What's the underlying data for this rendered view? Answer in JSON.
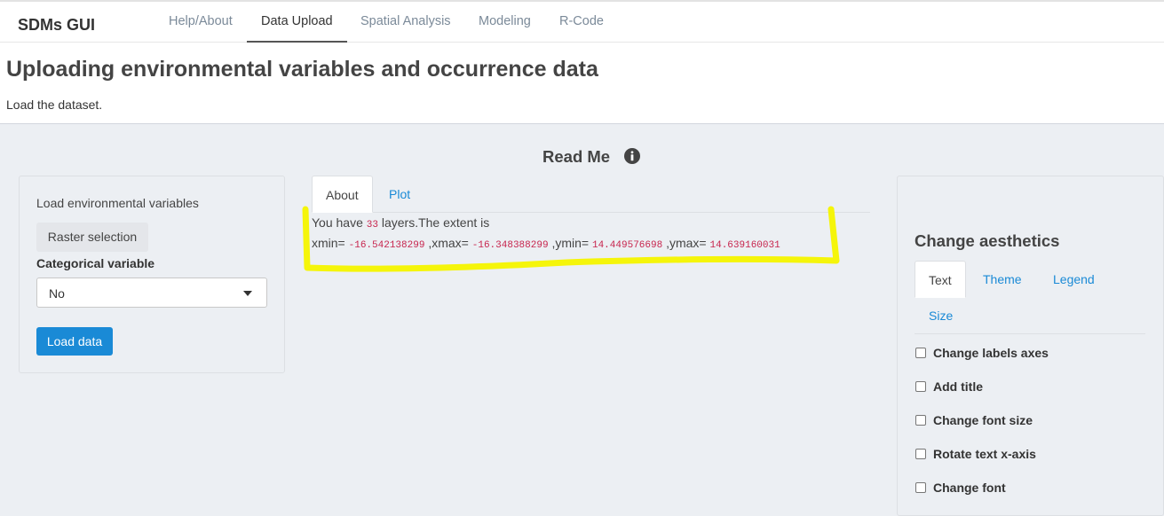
{
  "app": {
    "brand": "SDMs GUI"
  },
  "nav": {
    "tabs": [
      {
        "label": "Help/About"
      },
      {
        "label": "Data Upload"
      },
      {
        "label": "Spatial Analysis"
      },
      {
        "label": "Modeling"
      },
      {
        "label": "R-Code"
      }
    ],
    "active_index": 1
  },
  "header": {
    "title": "Uploading environmental variables and occurrence data",
    "subtitle": "Load the dataset."
  },
  "readme": {
    "label": "Read Me",
    "icon": "info-icon"
  },
  "left_panel": {
    "env_label": "Load environmental variables",
    "raster_button": "Raster selection",
    "categorical_label": "Categorical variable",
    "categorical_value": "No",
    "load_button": "Load data"
  },
  "main_tabs": {
    "tabs": [
      {
        "label": "About"
      },
      {
        "label": "Plot"
      }
    ],
    "active_index": 0
  },
  "about": {
    "prefix": "You have",
    "layers": "33",
    "suffix": "layers.The extent is",
    "xmin_label": "xmin=",
    "xmin": "-16.542138299",
    "xmax_label": ",xmax=",
    "xmax": "-16.348388299",
    "ymin_label": ",ymin=",
    "ymin": "14.449576698",
    "ymax_label": ",ymax=",
    "ymax": "14.639160031"
  },
  "aesthetics": {
    "title": "Change aesthetics",
    "tabs": [
      {
        "label": "Text"
      },
      {
        "label": "Theme"
      },
      {
        "label": "Legend"
      },
      {
        "label": "Size"
      }
    ],
    "active_index": 0,
    "options": [
      {
        "label": "Change labels axes",
        "checked": false
      },
      {
        "label": "Add title",
        "checked": false
      },
      {
        "label": "Change font size",
        "checked": false
      },
      {
        "label": "Rotate text x-axis",
        "checked": false
      },
      {
        "label": "Change font",
        "checked": false
      }
    ]
  },
  "colors": {
    "link": "#1a8ad6",
    "primary_button": "#1a8ad6",
    "code": "#c7254e",
    "highlight": "#f5f50a",
    "panel_bg": "#eceff3"
  }
}
